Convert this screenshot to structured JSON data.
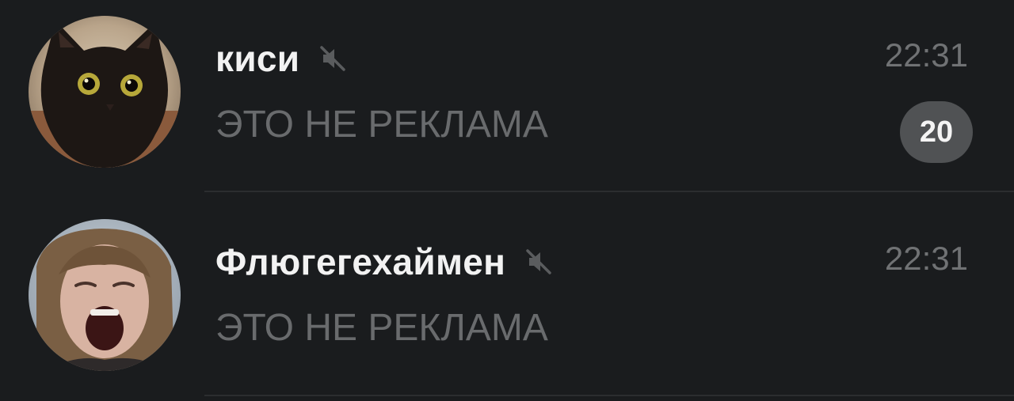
{
  "colors": {
    "background": "#1a1c1e",
    "name_text": "#f2f2f2",
    "secondary_text": "#696b6d",
    "badge_background": "#505254",
    "divider": "#2b2d2f"
  },
  "chats": [
    {
      "name": "киси",
      "muted": true,
      "mute_icon": "muted-speaker-icon",
      "time": "22:31",
      "preview": "ЭТО НЕ РЕКЛАМА",
      "unread_count": "20",
      "avatar": "black-cat-photo"
    },
    {
      "name": "Флюгегехаймен",
      "muted": true,
      "mute_icon": "muted-speaker-icon",
      "time": "22:31",
      "preview": "ЭТО НЕ РЕКЛАМА",
      "avatar": "screaming-person-photo"
    }
  ]
}
